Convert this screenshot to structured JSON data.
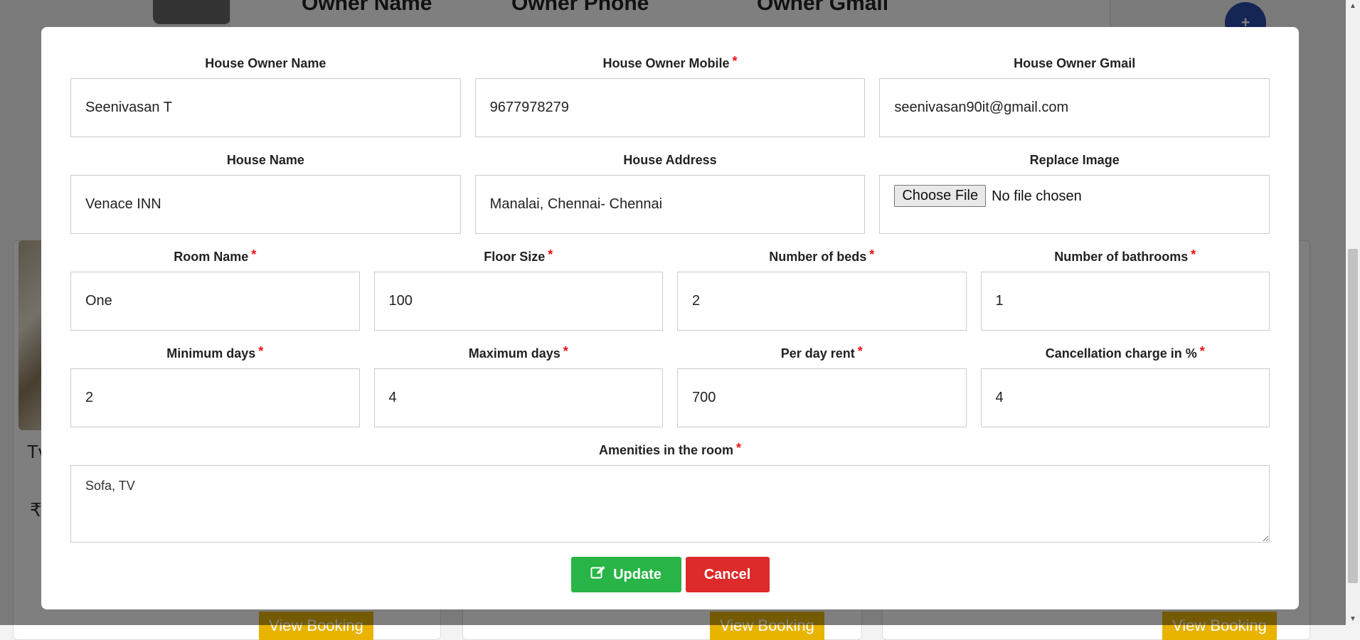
{
  "background": {
    "header_columns": [
      "Owner Name",
      "Owner Phone",
      "Owner Gmail"
    ],
    "plus_label": "+",
    "card_texts": [
      "Tv",
      "₹"
    ],
    "view_button_label": "View Booking"
  },
  "form": {
    "owner_name": {
      "label": "House Owner Name",
      "value": "Seenivasan T"
    },
    "owner_mobile": {
      "label": "House Owner Mobile",
      "value": "9677978279"
    },
    "owner_gmail": {
      "label": "House Owner Gmail",
      "value": "seenivasan90it@gmail.com"
    },
    "house_name": {
      "label": "House Name",
      "value": "Venace INN"
    },
    "house_address": {
      "label": "House Address",
      "value": "Manalai, Chennai- Chennai"
    },
    "replace_image": {
      "label": "Replace Image",
      "button": "Choose File",
      "status": "No file chosen"
    },
    "room_name": {
      "label": "Room Name",
      "value": "One"
    },
    "floor_size": {
      "label": "Floor Size",
      "value": "100"
    },
    "beds": {
      "label": "Number of beds",
      "value": "2"
    },
    "bathrooms": {
      "label": "Number of bathrooms",
      "value": "1"
    },
    "min_days": {
      "label": "Minimum days",
      "value": "2"
    },
    "max_days": {
      "label": "Maximum days",
      "value": "4"
    },
    "per_day_rent": {
      "label": "Per day rent",
      "value": "700"
    },
    "cancellation": {
      "label": "Cancellation charge in %",
      "value": "4"
    },
    "amenities": {
      "label": "Amenities in the room",
      "value": "Sofa, TV"
    },
    "required_mark": "*"
  },
  "actions": {
    "update_label": "Update",
    "cancel_label": "Cancel"
  },
  "colors": {
    "update": "#28b446",
    "cancel": "#dd2a2a",
    "required": "#e11111"
  },
  "icons": {
    "update": "edit-icon",
    "scroll_up": "scroll-up-arrow-icon",
    "scroll_down": "scroll-down-arrow-icon"
  }
}
